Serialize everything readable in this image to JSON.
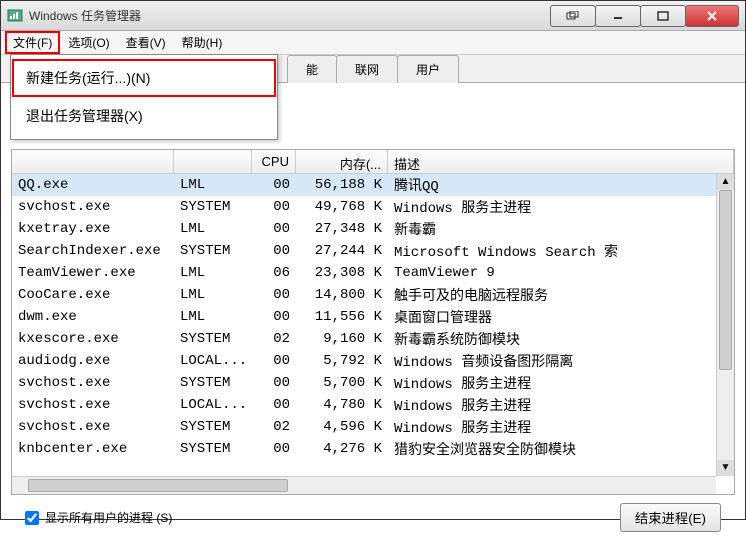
{
  "window": {
    "title": "Windows 任务管理器"
  },
  "menubar": {
    "file": "文件(F)",
    "options": "选项(O)",
    "view": "查看(V)",
    "help": "帮助(H)"
  },
  "file_menu": {
    "new_task": "新建任务(运行...)(N)",
    "exit": "退出任务管理器(X)"
  },
  "tabs": {
    "perf_partial": "能",
    "network": "联网",
    "users": "用户"
  },
  "columns": {
    "cpu": "CPU",
    "memory": "内存(...",
    "description": "描述"
  },
  "rows": [
    {
      "proc": "QQ.exe",
      "user": "LML",
      "cpu": "00",
      "mem": "56,188 K",
      "desc": "腾讯QQ",
      "sel": true
    },
    {
      "proc": "svchost.exe",
      "user": "SYSTEM",
      "cpu": "00",
      "mem": "49,768 K",
      "desc": "Windows 服务主进程"
    },
    {
      "proc": "kxetray.exe",
      "user": "LML",
      "cpu": "00",
      "mem": "27,348 K",
      "desc": "新毒霸"
    },
    {
      "proc": "SearchIndexer.exe",
      "user": "SYSTEM",
      "cpu": "00",
      "mem": "27,244 K",
      "desc": "Microsoft Windows Search 索"
    },
    {
      "proc": "TeamViewer.exe",
      "user": "LML",
      "cpu": "06",
      "mem": "23,308 K",
      "desc": "TeamViewer 9"
    },
    {
      "proc": "CooCare.exe",
      "user": "LML",
      "cpu": "00",
      "mem": "14,800 K",
      "desc": "触手可及的电脑远程服务"
    },
    {
      "proc": "dwm.exe",
      "user": "LML",
      "cpu": "00",
      "mem": "11,556 K",
      "desc": "桌面窗口管理器"
    },
    {
      "proc": "kxescore.exe",
      "user": "SYSTEM",
      "cpu": "02",
      "mem": "9,160 K",
      "desc": "新毒霸系统防御模块"
    },
    {
      "proc": "audiodg.exe",
      "user": "LOCAL...",
      "cpu": "00",
      "mem": "5,792 K",
      "desc": "Windows 音频设备图形隔离"
    },
    {
      "proc": "svchost.exe",
      "user": "SYSTEM",
      "cpu": "00",
      "mem": "5,700 K",
      "desc": "Windows 服务主进程"
    },
    {
      "proc": "svchost.exe",
      "user": "LOCAL...",
      "cpu": "00",
      "mem": "4,780 K",
      "desc": "Windows 服务主进程"
    },
    {
      "proc": "svchost.exe",
      "user": "SYSTEM",
      "cpu": "02",
      "mem": "4,596 K",
      "desc": "Windows 服务主进程"
    },
    {
      "proc": "knbcenter.exe",
      "user": "SYSTEM",
      "cpu": "00",
      "mem": "4,276 K",
      "desc": "猎豹安全浏览器安全防御模块"
    }
  ],
  "footer": {
    "show_all": "显示所有用户的进程 (S)",
    "end_process": "结束进程(E)"
  }
}
